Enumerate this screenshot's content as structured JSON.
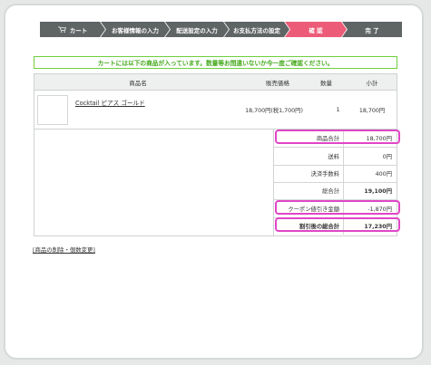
{
  "steps": [
    {
      "label": "カート",
      "active": false
    },
    {
      "label": "お客様情報の入力",
      "active": false
    },
    {
      "label": "配送設定の入力",
      "active": false
    },
    {
      "label": "お支払方法の設定",
      "active": false
    },
    {
      "label": "確 認",
      "active": true
    },
    {
      "label": "完 了",
      "active": false
    }
  ],
  "notice": "カートには以下の商品が入っています。数量等お間違いないか今一度ご確認ください。",
  "table": {
    "headers": {
      "product": "商品名",
      "price": "販売価格",
      "qty": "数量",
      "subtotal": "小計"
    },
    "item": {
      "name": "Cocktail ピアス ゴールド",
      "price": "18,700円(税1,700円)",
      "qty": "1",
      "subtotal": "18,700円"
    }
  },
  "summary": [
    {
      "label": "商品合計",
      "value": "18,700円"
    },
    {
      "label": "送料",
      "value": "0円"
    },
    {
      "label": "決済手数料",
      "value": "400円"
    },
    {
      "label": "総合計",
      "value": "19,100円"
    },
    {
      "label": "クーポン値引き金額",
      "value": "-1,870円"
    },
    {
      "label": "割引後の総合計",
      "value": "17,230円"
    }
  ],
  "edit_link": "[商品の削除・個数変更]",
  "colors": {
    "active_step": "#ec5c78",
    "step": "#5f6465",
    "notice": "#43a91a",
    "highlight": "#e046c6"
  }
}
